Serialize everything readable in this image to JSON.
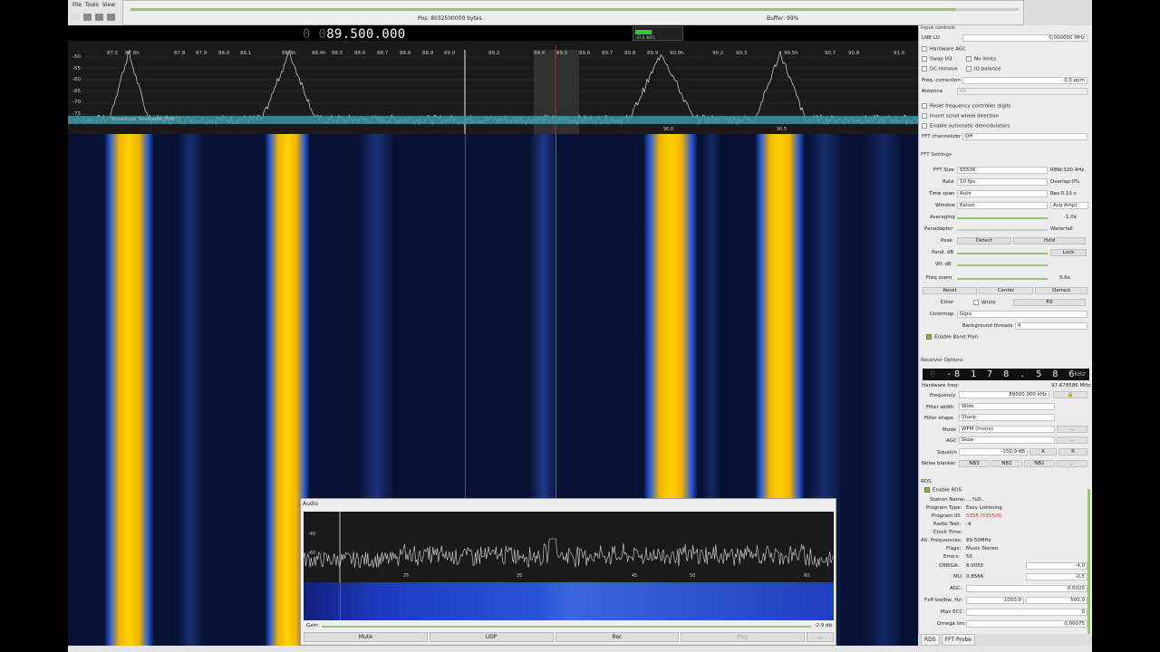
{
  "menu": {
    "file": "File",
    "tools": "Tools",
    "view": "View"
  },
  "progress": {
    "pos": "Pos: 8032500000 bytes",
    "buffer": "Buffer: 99%"
  },
  "main_freq": {
    "dim": "0 0",
    "value": "89.500.000"
  },
  "level_meter": {
    "readout": "-47.6 dBFS"
  },
  "spectrum": {
    "freq_ticks": [
      "87.5",
      "87.6h",
      "87.8",
      "87.9",
      "88.0",
      "88.1",
      "88.3h",
      "88.4h",
      "88.5",
      "88.6",
      "88.7",
      "88.8",
      "88.9",
      "89.0",
      "89.2",
      "89.4",
      "89.5",
      "89.6",
      "89.7",
      "89.8",
      "89.9",
      "90.0h",
      "90.2",
      "90.3",
      "90.5h",
      "90.7",
      "90.8",
      "91.0"
    ],
    "db_ticks": [
      "-50",
      "-55",
      "-60",
      "-65",
      "-70",
      "-75"
    ],
    "band_label": "Broadcast Television (FM)",
    "peak_markers": [
      "90.0",
      "90.5"
    ]
  },
  "audio": {
    "title": "Audio",
    "db_ticks": [
      "-40",
      "-60"
    ],
    "hz_ticks": [
      "25",
      "35",
      "45",
      "50",
      "60"
    ],
    "gain_label": "Gain:",
    "gain_value": "-2.9 db",
    "buttons": [
      "Mute",
      "UDP",
      "Rec",
      "Play",
      "..."
    ]
  },
  "input_controls": {
    "title": "Input controls",
    "lnb_label": "LNB LO",
    "lnb_value": "0,000000 MHz",
    "hw_agc": "Hardware AGC",
    "swap_iq": "Swap I/Q",
    "no_limits": "No limits",
    "dc_remove": "DC remove",
    "iq_balance": "IQ balance",
    "freq_corr_label": "Freq. correction",
    "freq_corr_value": "0,0 ppm",
    "antenna_label": "Antenna",
    "antenna_value": "RX",
    "reset_digits": "Reset frequency controller digits",
    "invert_scroll": "Invert scroll wheel direction",
    "auto_demod": "Enable automatic demodulators",
    "fft_chan_label": "FFT channelizer",
    "fft_chan_value": "Off"
  },
  "fft_settings": {
    "title": "FFT Settings",
    "fft_size_label": "FFT Size",
    "fft_size_value": "65536",
    "rbw": "RBW:320.4Hz",
    "rate_label": "Rate",
    "rate_value": "10 fps",
    "overlap": "Overlap:0%",
    "timespan_label": "Time span",
    "timespan_value": "Auto",
    "res": "Res:0.10 s",
    "window_label": "Window",
    "window_value": "Kaiser",
    "avg_value": "Avg Ampl.",
    "averaging_label": "Averaging",
    "averaging_value": "-1.0x",
    "panadapter_label": "Panadapter",
    "waterfall_label": "Waterfall",
    "peak_label": "Peak",
    "detect_btn": "Detect",
    "hold_btn": "Hold",
    "pand_db_label": "Pand. dB",
    "lock_btn": "Lock",
    "wf_db_label": "Wf. dB",
    "freq_zoom_label": "Freq zoom",
    "freq_zoom_value": "5.6x",
    "reset_btn": "Reset",
    "center_btn": "Center",
    "demod_btn": "Demod",
    "color_label": "Color",
    "white_label": "White",
    "fill_btn": "Fill",
    "colormap_label": "Colormap",
    "colormap_value": "Gqrx",
    "bg_threads_label": "Background threads",
    "bg_threads_value": "4",
    "band_plan": "Enable Band Plan"
  },
  "receiver": {
    "title": "Receiver Options",
    "lcd_dim": "0",
    "lcd_value": "-8 1 7 8 . 5 8 6",
    "lcd_unit": "kHz",
    "hw_freq_label": "Hardware freq:",
    "hw_freq_value": "97.678586 MHz",
    "freq_label": "Frequency",
    "freq_value": "89500.000 kHz",
    "filter_width_label": "Filter width",
    "filter_width_value": "Wide",
    "filter_shape_label": "Filter shape",
    "filter_shape_value": "Sharp",
    "mode_label": "Mode",
    "mode_value": "WFM (mono)",
    "agc_label": "AGC",
    "agc_value": "Slow",
    "squelch_label": "Squelch",
    "squelch_value": "-150,0 dB",
    "a_btn": "A",
    "r_btn": "R",
    "nb_label": "Noise blanker",
    "nb3": "NB3",
    "nb2": "NB2",
    "nb1": "NB1",
    "dots": "..."
  },
  "rds": {
    "title": "RDS",
    "enable": "Enable RDS",
    "station_label": "Station Name:",
    "station_value": "....%D..",
    "ptype_label": "Program Type:",
    "ptype_value": "Easy Listening",
    "pid_label": "Program ID:",
    "pid_value": "5355 (5355/0)",
    "radiotext_label": "Radio Text:",
    "radiotext_value": ":4",
    "clock_label": "Clock Time:",
    "clock_value": "",
    "alt_label": "Alt. Frequencies:",
    "alt_value": "89.50MHz",
    "flags_label": "Flags:",
    "flags_value": "Music Stereo",
    "errors_label": "Errors:",
    "errors_value": "50",
    "omega_label": "OMEGA:",
    "omega_value": "8.0055",
    "omega_box": "-4,0",
    "mu_label": "MU:",
    "mu_value": "0.8566",
    "mu_box": "-0,5",
    "agc_label": "AGC:",
    "agc_box": "0,0020",
    "fxff_label": "Fxff bw/bw, Hz:",
    "fxff_box1": "1050,0",
    "fxff_box2": "500,0",
    "maxecc_label": "Max ECC:",
    "maxecc_box": "0",
    "omegalim_label": "Omega lim:",
    "omegalim_box": "0,00075"
  },
  "tabs": [
    "RDS",
    "FFT Probe"
  ]
}
